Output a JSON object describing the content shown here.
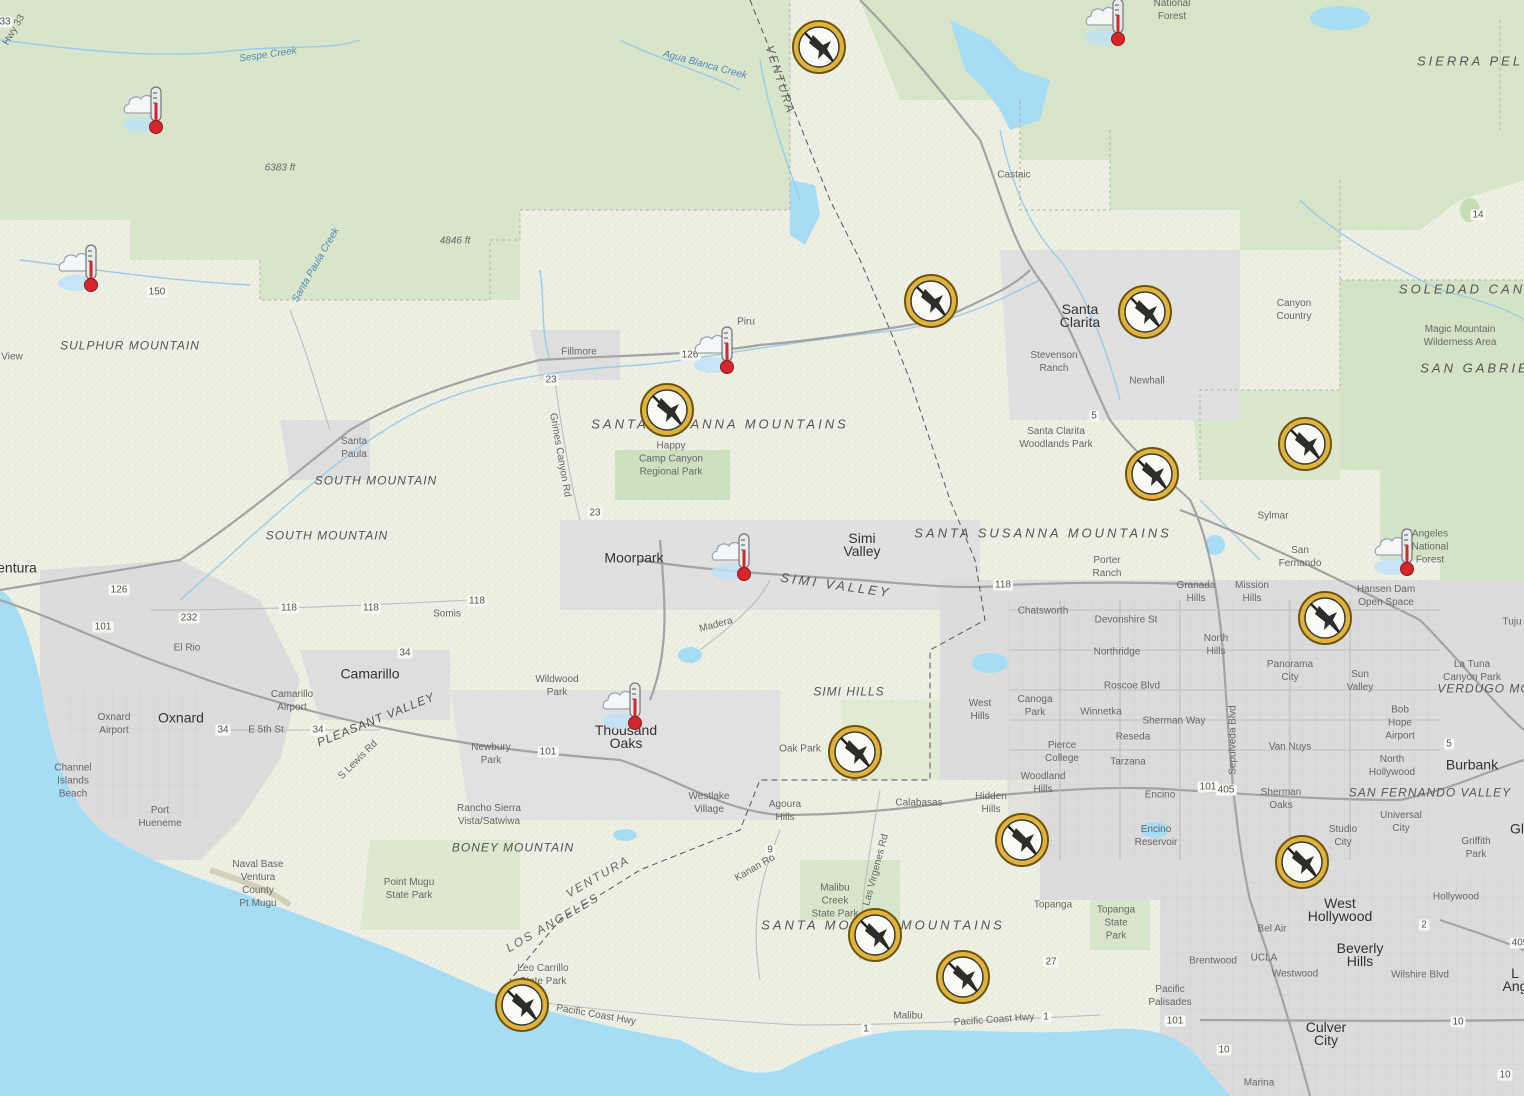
{
  "map": {
    "labels": [
      {
        "key": "hwy-33",
        "text": "Hwy 33",
        "cls": "small"
      },
      {
        "key": "sespe-creek",
        "text": "Sespe Creek",
        "cls": "water"
      },
      {
        "key": "agua-blanca-creek",
        "text": "Agua Blanca Creek",
        "cls": "water"
      },
      {
        "key": "ventura-county-top",
        "text": "VENTURA",
        "cls": "county"
      },
      {
        "key": "national-forest",
        "text": "National\nForest",
        "cls": "small"
      },
      {
        "key": "sierra-pelona",
        "text": "SIERRA PEL",
        "cls": "mtn"
      },
      {
        "key": "elev-6383",
        "text": "6383 ft",
        "cls": "elev"
      },
      {
        "key": "elev-4846",
        "text": "4846 ft",
        "cls": "elev"
      },
      {
        "key": "santa-paula-creek",
        "text": "Santa Paula Creek",
        "cls": "water"
      },
      {
        "key": "castaic",
        "text": "Castaic",
        "cls": "small"
      },
      {
        "key": "soledad-canyon",
        "text": "SOLEDAD CAN",
        "cls": "mtn"
      },
      {
        "key": "sulphur-mountain",
        "text": "SULPHUR MOUNTAIN",
        "cls": "mtnsm"
      },
      {
        "key": "view",
        "text": "View",
        "cls": "small"
      },
      {
        "key": "fillmore",
        "text": "Fillmore",
        "cls": "small"
      },
      {
        "key": "piru",
        "text": "Piru",
        "cls": "small"
      },
      {
        "key": "santa-clarita",
        "text": "Santa\nClarita",
        "cls": "city"
      },
      {
        "key": "canyon-country",
        "text": "Canyon\nCountry",
        "cls": "small"
      },
      {
        "key": "magic-mountain",
        "text": "Magic Mountain\nWilderness Area",
        "cls": "small"
      },
      {
        "key": "san-gabriel",
        "text": "SAN GABRIE",
        "cls": "mtn"
      },
      {
        "key": "stevenson-ranch",
        "text": "Stevenson\nRanch",
        "cls": "small"
      },
      {
        "key": "newhall",
        "text": "Newhall",
        "cls": "small"
      },
      {
        "key": "santa-susana-mtns-1",
        "text": "SANTA SUSANNA MOUNTAINS",
        "cls": "mtn"
      },
      {
        "key": "santa-paula",
        "text": "Santa\nPaula",
        "cls": "small"
      },
      {
        "key": "happy-camp",
        "text": "Happy\nCamp Canyon\nRegional Park",
        "cls": "small"
      },
      {
        "key": "santa-clarita-woodlands",
        "text": "Santa Clarita\nWoodlands Park",
        "cls": "small"
      },
      {
        "key": "south-mountain-1",
        "text": "SOUTH MOUNTAIN",
        "cls": "mtnsm"
      },
      {
        "key": "south-mountain-2",
        "text": "SOUTH MOUNTAIN",
        "cls": "mtnsm"
      },
      {
        "key": "grimes-canyon",
        "text": "Grimes Canyon Rd",
        "cls": "small"
      },
      {
        "key": "sylmar",
        "text": "Sylmar",
        "cls": "small"
      },
      {
        "key": "simi-valley-city",
        "text": "Simi\nValley",
        "cls": "city"
      },
      {
        "key": "santa-susana-mtns-2",
        "text": "SANTA SUSANNA MOUNTAINS",
        "cls": "mtn"
      },
      {
        "key": "ventura",
        "text": "entura",
        "cls": "city"
      },
      {
        "key": "moorpark",
        "text": "Moorpark",
        "cls": "city"
      },
      {
        "key": "simi-valley-region",
        "text": "SIMI VALLEY",
        "cls": "mtn"
      },
      {
        "key": "porter-ranch",
        "text": "Porter\nRanch",
        "cls": "small"
      },
      {
        "key": "san-fernando",
        "text": "San\nFernando",
        "cls": "small"
      },
      {
        "key": "angeles-nf",
        "text": "Angeles\nNational\nForest",
        "cls": "small"
      },
      {
        "key": "granada-hills",
        "text": "Granada\nHills",
        "cls": "small"
      },
      {
        "key": "mission-hills",
        "text": "Mission\nHills",
        "cls": "small"
      },
      {
        "key": "hansen-dam",
        "text": "Hansen Dam\nOpen Space",
        "cls": "small"
      },
      {
        "key": "tujunga",
        "text": "Tuju",
        "cls": "small"
      },
      {
        "key": "chatsworth",
        "text": "Chatsworth",
        "cls": "small"
      },
      {
        "key": "devonshire",
        "text": "Devonshire St",
        "cls": "small"
      },
      {
        "key": "somis",
        "text": "Somis",
        "cls": "small"
      },
      {
        "key": "el-rio",
        "text": "El Rio",
        "cls": "small"
      },
      {
        "key": "northridge",
        "text": "Northridge",
        "cls": "small"
      },
      {
        "key": "north-hills",
        "text": "North\nHills",
        "cls": "small"
      },
      {
        "key": "madera",
        "text": "Madera",
        "cls": "small"
      },
      {
        "key": "camarillo",
        "text": "Camarillo",
        "cls": "city"
      },
      {
        "key": "wildwood-park",
        "text": "Wildwood\nPark",
        "cls": "small"
      },
      {
        "key": "panorama-city",
        "text": "Panorama\nCity",
        "cls": "small"
      },
      {
        "key": "sun-valley",
        "text": "Sun\nValley",
        "cls": "small"
      },
      {
        "key": "la-tuna",
        "text": "La Tuna\nCanyon Park",
        "cls": "small"
      },
      {
        "key": "verdugo",
        "text": "VERDUGO MO",
        "cls": "mtnsm"
      },
      {
        "key": "roscoe",
        "text": "Roscoe Blvd",
        "cls": "small"
      },
      {
        "key": "simi-hills",
        "text": "SIMI HILLS",
        "cls": "mtnsm"
      },
      {
        "key": "camarillo-airport",
        "text": "Camarillo\nAirport",
        "cls": "small"
      },
      {
        "key": "oxnard",
        "text": "Oxnard",
        "cls": "city"
      },
      {
        "key": "oxnard-airport",
        "text": "Oxnard\nAirport",
        "cls": "small"
      },
      {
        "key": "pleasant-valley",
        "text": "PLEASANT VALLEY",
        "cls": "mtnsm"
      },
      {
        "key": "west-hills",
        "text": "West\nHills",
        "cls": "small"
      },
      {
        "key": "canoga-park",
        "text": "Canoga\nPark",
        "cls": "small"
      },
      {
        "key": "winnetka",
        "text": "Winnetka",
        "cls": "small"
      },
      {
        "key": "sherman-way",
        "text": "Sherman Way",
        "cls": "small"
      },
      {
        "key": "bob-hope",
        "text": "Bob\nHope\nAirport",
        "cls": "small"
      },
      {
        "key": "e-5th-st",
        "text": "E 5th St",
        "cls": "small"
      },
      {
        "key": "thousand-oaks",
        "text": "Thousand\nOaks",
        "cls": "city"
      },
      {
        "key": "reseda",
        "text": "Reseda",
        "cls": "small"
      },
      {
        "key": "lewis-rd",
        "text": "S Lewis Rd",
        "cls": "small"
      },
      {
        "key": "newbury-park",
        "text": "Newbury\nPark",
        "cls": "small"
      },
      {
        "key": "oak-park",
        "text": "Oak Park",
        "cls": "small"
      },
      {
        "key": "pierce-college",
        "text": "Pierce\nCollege",
        "cls": "small"
      },
      {
        "key": "van-nuys",
        "text": "Van Nuys",
        "cls": "small"
      },
      {
        "key": "burbank",
        "text": "Burbank",
        "cls": "city"
      },
      {
        "key": "channel-islands",
        "text": "Channel\nIslands\nBeach",
        "cls": "small"
      },
      {
        "key": "tarzana",
        "text": "Tarzana",
        "cls": "small"
      },
      {
        "key": "north-hollywood",
        "text": "North\nHollywood",
        "cls": "small"
      },
      {
        "key": "woodland-hills",
        "text": "Woodland\nHills",
        "cls": "small"
      },
      {
        "key": "encino",
        "text": "Encino",
        "cls": "small"
      },
      {
        "key": "sepulveda",
        "text": "Sepulveda Blvd",
        "cls": "small"
      },
      {
        "key": "sfv",
        "text": "SAN FERNANDO VALLEY",
        "cls": "mtnsm"
      },
      {
        "key": "hidden-hills",
        "text": "Hidden\nHills",
        "cls": "small"
      },
      {
        "key": "westlake",
        "text": "Westlake\nVillage",
        "cls": "small"
      },
      {
        "key": "agoura-hills",
        "text": "Agoura\nHills",
        "cls": "small"
      },
      {
        "key": "calabasas",
        "text": "Calabasas",
        "cls": "small"
      },
      {
        "key": "sherman-oaks",
        "text": "Sherman\nOaks",
        "cls": "small"
      },
      {
        "key": "port-hueneme",
        "text": "Port\nHueneme",
        "cls": "small"
      },
      {
        "key": "rancho-sierra",
        "text": "Rancho Sierra\nVista/Satwiwa",
        "cls": "small"
      },
      {
        "key": "universal-city",
        "text": "Universal\nCity",
        "cls": "small"
      },
      {
        "key": "encino-reservoir",
        "text": "Encino\nReservoir",
        "cls": "small"
      },
      {
        "key": "studio-city",
        "text": "Studio\nCity",
        "cls": "small"
      },
      {
        "key": "griffith",
        "text": "Griffith\nPark",
        "cls": "small"
      },
      {
        "key": "boney-mountain",
        "text": "BONEY MOUNTAIN",
        "cls": "mtnsm"
      },
      {
        "key": "naval-base",
        "text": "Naval Base\nVentura\nCounty\nPt Mugu",
        "cls": "small"
      },
      {
        "key": "ventura-county-bottom",
        "text": "VENTURA",
        "cls": "county"
      },
      {
        "key": "los-angeles-county",
        "text": "LOS ANGELES",
        "cls": "county"
      },
      {
        "key": "kanan",
        "text": "Kanan Rd",
        "cls": "small"
      },
      {
        "key": "las-virgenes",
        "text": "Las Virgenes Rd",
        "cls": "small"
      },
      {
        "key": "point-mugu",
        "text": "Point Mugu\nState Park",
        "cls": "small"
      },
      {
        "key": "malibu-creek",
        "text": "Malibu\nCreek\nState Park",
        "cls": "small"
      },
      {
        "key": "topanga",
        "text": "Topanga",
        "cls": "small"
      },
      {
        "key": "topanga-sp",
        "text": "Topanga\nState\nPark",
        "cls": "small"
      },
      {
        "key": "west-hollywood",
        "text": "West\nHollywood",
        "cls": "city"
      },
      {
        "key": "hollywood",
        "text": "Hollywood",
        "cls": "small"
      },
      {
        "key": "santa-monica-mtns",
        "text": "SANTA MONICA MOUNTAINS",
        "cls": "mtn"
      },
      {
        "key": "bel-air",
        "text": "Bel Air",
        "cls": "small"
      },
      {
        "key": "ucla",
        "text": "UCLA",
        "cls": "small"
      },
      {
        "key": "beverly-hills",
        "text": "Beverly\nHills",
        "cls": "city"
      },
      {
        "key": "brentwood",
        "text": "Brentwood",
        "cls": "small"
      },
      {
        "key": "westwood",
        "text": "Westwood",
        "cls": "small"
      },
      {
        "key": "wilshire",
        "text": "Wilshire Blvd",
        "cls": "small"
      },
      {
        "key": "leo-carrillo",
        "text": "Leo Carrillo\nState Park",
        "cls": "small"
      },
      {
        "key": "pacific-palisades",
        "text": "Pacific\nPalisades",
        "cls": "small"
      },
      {
        "key": "pch-1",
        "text": "Pacific Coast Hwy",
        "cls": "small"
      },
      {
        "key": "malibu",
        "text": "Malibu",
        "cls": "small"
      },
      {
        "key": "pch-2",
        "text": "Pacific Coast Hwy",
        "cls": "small"
      },
      {
        "key": "culver-city",
        "text": "Culver\nCity",
        "cls": "city"
      },
      {
        "key": "marina",
        "text": "Marina",
        "cls": "small"
      },
      {
        "key": "la-partial",
        "text": "L\nAng",
        "cls": "city"
      },
      {
        "key": "gl",
        "text": "Gl",
        "cls": "city"
      }
    ],
    "shields": [
      "33",
      "150",
      "126",
      "126",
      "23",
      "23",
      "118",
      "118",
      "118",
      "118",
      "101",
      "232",
      "34",
      "34",
      "34",
      "101",
      "101",
      "5",
      "5",
      "405",
      "101",
      "10",
      "14",
      "2",
      "10",
      "1",
      "1",
      "27",
      "9",
      "405",
      "10"
    ],
    "weather_markers": 7,
    "fire_markers": 13,
    "colors": {
      "ocean": "#a7dcf5",
      "land": "#eef0e4",
      "forest": "#d5e4c8",
      "urban": "#dcdcdc",
      "road": "#9a9a9a",
      "river": "#9ccbe8",
      "fire_ring": "#e0b43c",
      "thermo_red": "#d6262b"
    },
    "icons": {
      "weather": "cloud-thermometer-icon",
      "fire": "fire-aircraft-icon"
    }
  }
}
